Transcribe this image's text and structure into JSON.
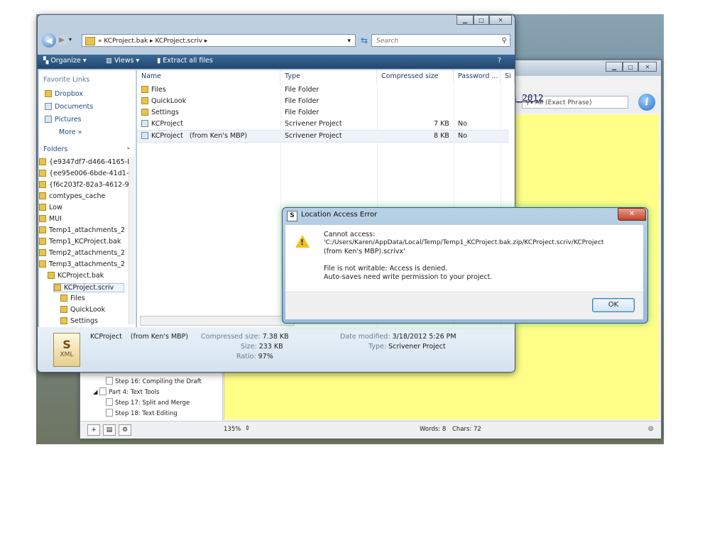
{
  "scrivener": {
    "search_placeholder": "All (Exact Phrase)",
    "editor_text": "riv/attachments_2012",
    "binder_items": [
      "Step 16: Compiling the Draft",
      "Part 4: Text Tools",
      "Step 17: Split and Merge",
      "Step 18: Text Editing"
    ],
    "zoom": "135%",
    "words": "Words: 8",
    "chars": "Chars: 72"
  },
  "explorer": {
    "breadcrumb": [
      "KCProject.bak",
      "KCProject.scriv"
    ],
    "breadcrumb_prefix": "«",
    "search_placeholder": "Search",
    "commands": [
      "Organize",
      "Views",
      "Extract all files"
    ],
    "favorite_links_header": "Favorite Links",
    "favorite_links": [
      "Dropbox",
      "Documents",
      "Pictures"
    ],
    "more_label": "More »",
    "folders_header": "Folders",
    "folder_tree": [
      "{e9347df7-d466-4165-I",
      "{ee95e006-6bde-41d1-",
      "{f6c203f2-82a3-4612-9",
      "comtypes_cache",
      "Low",
      "MUI",
      "Temp1_attachments_2",
      "Temp1_KCProject.bak",
      "Temp2_attachments_2",
      "Temp3_attachments_2",
      "KCProject.bak",
      "KCProject.scriv",
      "Files",
      "QuickLook",
      "Settings"
    ],
    "columns": [
      "Name",
      "Type",
      "Compressed size",
      "Password ...",
      "Si"
    ],
    "files": [
      {
        "name": "Files",
        "type": "File Folder",
        "size": "",
        "password": ""
      },
      {
        "name": "QuickLook",
        "type": "File Folder",
        "size": "",
        "password": ""
      },
      {
        "name": "Settings",
        "type": "File Folder",
        "size": "",
        "password": ""
      },
      {
        "name": "KCProject",
        "type": "Scrivener Project",
        "size": "7 KB",
        "password": "No"
      },
      {
        "name": "KCProject   (from Ken's MBP)",
        "type": "Scrivener Project",
        "size": "8 KB",
        "password": "No"
      }
    ],
    "details": {
      "name": "KCProject    (from Ken's MBP)",
      "compressed_label": "Compressed size:",
      "compressed": "7.38 KB",
      "size_label": "Size:",
      "size": "233 KB",
      "ratio_label": "Ratio:",
      "ratio": "97%",
      "modified_label": "Date modified:",
      "modified": "3/18/2012 5:26 PM",
      "type_label": "Type:",
      "type": "Scrivener Project",
      "icon_text": "XML"
    }
  },
  "dialog": {
    "title": "Location Access Error",
    "line1": "Cannot access:",
    "line2": "'C:/Users/Karen/AppData/Local/Temp/Temp1_KCProject.bak.zip/KCProject.scriv/KCProject",
    "line3": "(from Ken's MBP).scrivx'",
    "line4": "File is not writable: Access is denied.",
    "line5": "Auto-saves need write permission to your project.",
    "ok": "OK"
  }
}
